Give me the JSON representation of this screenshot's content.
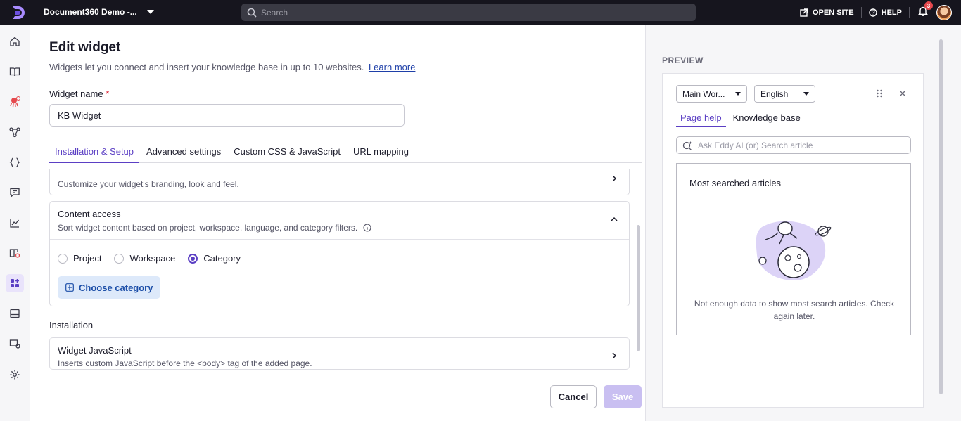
{
  "topbar": {
    "project_name": "Document360 Demo -...",
    "search_placeholder": "Search",
    "open_site_label": "OPEN SITE",
    "help_label": "HELP",
    "notification_count": "3"
  },
  "rail": {
    "items": [
      "home-icon",
      "book-icon",
      "robot-icon",
      "workflow-icon",
      "code-braces-icon",
      "chat-icon",
      "analytics-icon",
      "knowledge-settings-icon",
      "widget-icon",
      "layout-icon",
      "portal-settings-icon",
      "settings-icon"
    ],
    "active": "widget-icon"
  },
  "page": {
    "title": "Edit widget",
    "subtitle": "Widgets let you connect and insert your knowledge base in up to 10 websites.",
    "learn_more": "Learn more",
    "widget_name_label": "Widget name",
    "required_mark": "*",
    "widget_name_value": "KB Widget"
  },
  "tabs": [
    {
      "label": "Installation & Setup",
      "active": true
    },
    {
      "label": "Advanced settings",
      "active": false
    },
    {
      "label": "Custom CSS & JavaScript",
      "active": false
    },
    {
      "label": "URL mapping",
      "active": false
    }
  ],
  "cards": {
    "appearance_desc": "Customize your widget's branding, look and feel.",
    "content_access_title": "Content access",
    "content_access_desc": "Sort widget content based on project, workspace, language, and category filters.",
    "radio_options": [
      "Project",
      "Workspace",
      "Category"
    ],
    "radio_selected": "Category",
    "choose_category_label": "Choose category",
    "installation_label": "Installation",
    "widget_js_title": "Widget JavaScript",
    "widget_js_desc": "Inserts custom JavaScript before the <body> tag of the added page."
  },
  "footer": {
    "cancel_label": "Cancel",
    "save_label": "Save"
  },
  "preview": {
    "label": "PREVIEW",
    "workspace_select": "Main Wor...",
    "language_select": "English",
    "tab_page_help": "Page help",
    "tab_knowledge_base": "Knowledge base",
    "search_placeholder": "Ask Eddy AI (or) Search article",
    "most_searched_title": "Most searched articles",
    "empty_message": "Not enough data to show most search articles. Check again later."
  },
  "colors": {
    "accent": "#5b3fc4",
    "topbar_bg": "#16151e",
    "choose_btn_bg": "#dde9fa",
    "save_disabled_bg": "#c9bff1"
  }
}
